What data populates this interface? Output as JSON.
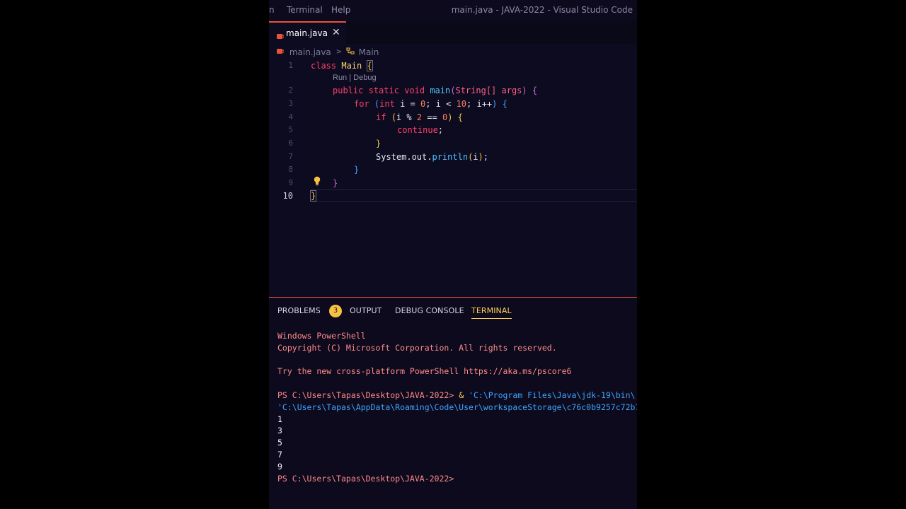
{
  "titlebar": {
    "menu": [
      "n",
      "Terminal",
      "Help"
    ],
    "title": "main.java - JAVA-2022 - Visual Studio Code"
  },
  "tab": {
    "label": "main.java",
    "close": "✕"
  },
  "breadcrumb": {
    "file": "main.java",
    "separator": ">",
    "symbol": "Main"
  },
  "editor": {
    "line_numbers": [
      "1",
      "2",
      "3",
      "4",
      "5",
      "6",
      "7",
      "8",
      "9",
      "10"
    ],
    "codelens": "Run | Debug",
    "code": {
      "l1_kw": "class",
      "l1_name": "Main",
      "l1_brace": "{",
      "l2_public": "public",
      "l2_static": "static",
      "l2_void": "void",
      "l2_fn": "main",
      "l2_po": "(",
      "l2_type": "String[]",
      "l2_arg": "args",
      "l2_pc": ")",
      "l2_brace": "{",
      "l3_for": "for",
      "l3_po": "(",
      "l3_int": "int",
      "l3_rest1": "i = ",
      "l3_zero": "0",
      "l3_rest2": "; i < ",
      "l3_ten": "10",
      "l3_rest3": "; i++",
      "l3_pc": ")",
      "l3_brace": "{",
      "l4_if": "if",
      "l4_po": "(",
      "l4_rest1": "i % ",
      "l4_two": "2",
      "l4_rest2": " == ",
      "l4_zero": "0",
      "l4_pc": ")",
      "l4_brace": "{",
      "l5_continue": "continue",
      "l5_semi": ";",
      "l6_brace": "}",
      "l7_sys": "System.out.",
      "l7_fn": "println",
      "l7_po": "(",
      "l7_arg": "i",
      "l7_pc": ")",
      "l7_semi": ";",
      "l8_brace": "}",
      "l9_brace": "}",
      "l10_brace": "}"
    }
  },
  "panel": {
    "tabs": {
      "problems": "PROBLEMS",
      "problems_count": "3",
      "output": "OUTPUT",
      "debug_console": "DEBUG CONSOLE",
      "terminal": "TERMINAL"
    },
    "terminal_lines": {
      "ps_header": "Windows PowerShell",
      "copyright": "Copyright (C) Microsoft Corporation. All rights reserved.",
      "try_new": "Try the new cross-platform PowerShell https://aka.ms/pscore6",
      "prompt1": "PS C:\\Users\\Tapas\\Desktop\\JAVA-2022> ",
      "cmd_amp": "& ",
      "cmd_java": "'C:\\Program Files\\Java\\jdk-19\\bin\\",
      "cmd_args": "'C:\\Users\\Tapas\\AppData\\Roaming\\Code\\User\\workspaceStorage\\c76c0b9257c72b7",
      "out1": "1",
      "out2": "3",
      "out3": "5",
      "out4": "7",
      "out5": "9",
      "prompt2": "PS C:\\Users\\Tapas\\Desktop\\JAVA-2022> "
    }
  },
  "colors": {
    "accent": "#e8533b",
    "terminal_tab_active": "#ffd15a",
    "keyword": "#ff3f6c",
    "function": "#4fc3ff"
  }
}
